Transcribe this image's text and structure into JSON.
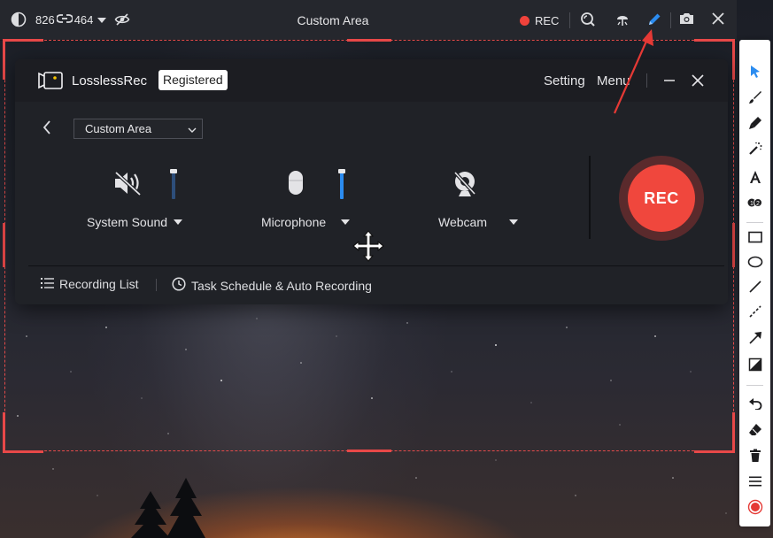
{
  "toolbar": {
    "width_value": "826",
    "height_value": "464",
    "title": "Custom Area",
    "rec_label": "REC",
    "accent_color": "#2b8cf0",
    "rec_color": "#f0423b"
  },
  "app": {
    "brand": "LosslessRec",
    "badge": "Registered",
    "setting_label": "Setting",
    "menu_label": "Menu",
    "mode_value": "Custom Area",
    "sources": [
      {
        "label": "System Sound",
        "icon": "speaker-muted-icon",
        "level": 0.9,
        "active": false
      },
      {
        "label": "Microphone",
        "icon": "microphone-icon",
        "level": 0.9,
        "active": true
      },
      {
        "label": "Webcam",
        "icon": "webcam-off-icon"
      }
    ],
    "rec_button_label": "REC",
    "rec_button_color": "#f0473d",
    "footer": {
      "recording_list": "Recording List",
      "schedule": "Task Schedule & Auto Recording"
    }
  },
  "annotation_tools": [
    "cursor-icon",
    "brush-icon",
    "marker-icon",
    "magic-wand-icon",
    "text-icon",
    "number-step-icon",
    "rectangle-icon",
    "ellipse-icon",
    "line-icon",
    "dashed-line-icon",
    "arrow-icon",
    "fill-icon",
    "undo-icon",
    "eraser-icon",
    "trash-icon",
    "menu-icon",
    "record-icon"
  ]
}
